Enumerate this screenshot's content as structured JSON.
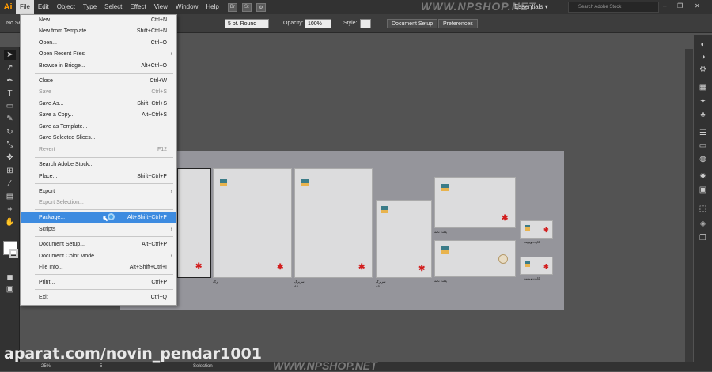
{
  "app_logo": "Ai",
  "menus": [
    "File",
    "Edit",
    "Object",
    "Type",
    "Select",
    "Effect",
    "View",
    "Window",
    "Help"
  ],
  "app_buttons": [
    "Br",
    "St"
  ],
  "workspace": "Essentials",
  "search_placeholder": "Search Adobe Stock",
  "window_controls": [
    "–",
    "❐",
    "✕"
  ],
  "control_bar": {
    "selection_label": "No Se",
    "brush": "5 pt. Round",
    "opacity_label": "Opacity:",
    "opacity_value": "100%",
    "style_label": "Style:",
    "doc_setup": "Document Setup",
    "preferences": "Preferences"
  },
  "file_menu": {
    "items": [
      {
        "label": "New...",
        "shortcut": "Ctrl+N"
      },
      {
        "label": "New from Template...",
        "shortcut": "Shift+Ctrl+N"
      },
      {
        "label": "Open...",
        "shortcut": "Ctrl+O"
      },
      {
        "label": "Open Recent Files",
        "shortcut": ""
      },
      {
        "label": "Browse in Bridge...",
        "shortcut": "Alt+Ctrl+O"
      },
      {
        "label": "Close",
        "shortcut": "Ctrl+W"
      },
      {
        "label": "Save",
        "shortcut": "Ctrl+S"
      },
      {
        "label": "Save As...",
        "shortcut": "Shift+Ctrl+S"
      },
      {
        "label": "Save a Copy...",
        "shortcut": "Alt+Ctrl+S"
      },
      {
        "label": "Save as Template...",
        "shortcut": ""
      },
      {
        "label": "Save Selected Slices...",
        "shortcut": ""
      },
      {
        "label": "Revert",
        "shortcut": "F12"
      },
      {
        "label": "Search Adobe Stock...",
        "shortcut": ""
      },
      {
        "label": "Place...",
        "shortcut": "Shift+Ctrl+P"
      },
      {
        "label": "Export",
        "shortcut": ""
      },
      {
        "label": "Export Selection...",
        "shortcut": ""
      },
      {
        "label": "Package...",
        "shortcut": "Alt+Shift+Ctrl+P"
      },
      {
        "label": "Scripts",
        "shortcut": ""
      },
      {
        "label": "Document Setup...",
        "shortcut": "Alt+Ctrl+P"
      },
      {
        "label": "Document Color Mode",
        "shortcut": ""
      },
      {
        "label": "File Info...",
        "shortcut": "Alt+Shift+Ctrl+I"
      },
      {
        "label": "Print...",
        "shortcut": "Ctrl+P"
      },
      {
        "label": "Exit",
        "shortcut": "Ctrl+Q"
      }
    ]
  },
  "artboard_labels": {
    "a2": "برگه",
    "a3": "سربرگ",
    "a3_size": "A4",
    "a4": "سربرگ",
    "a4_size": "A5",
    "a5": "پاکت نامه",
    "a6": "پاکت نامه",
    "a7": "کارت ویزیت",
    "a8": "کارت ویزیت"
  },
  "status": {
    "zoom": "25%",
    "artboard_num": "5",
    "tool": "Selection"
  },
  "watermarks": {
    "top": "WWW.NPSHOP.NET",
    "bottom_left": "aparat.com/novin_pendar1001",
    "bottom_center": "WWW.NPSHOP.NET"
  },
  "colors": {
    "accent_highlight": "#3d8be0",
    "logo_orange": "#ff9a00",
    "figure_red": "#d21e1e"
  }
}
